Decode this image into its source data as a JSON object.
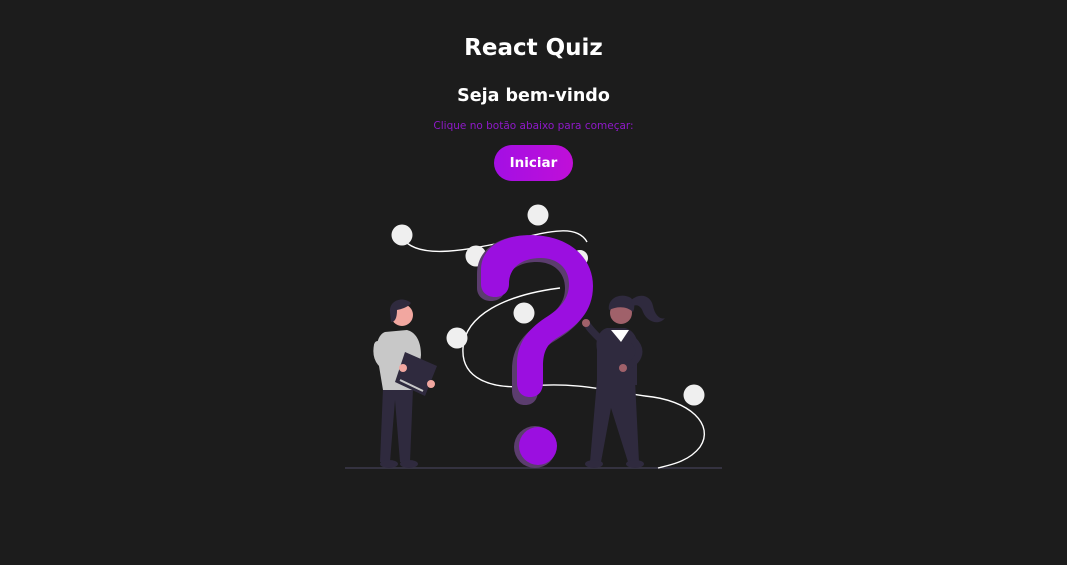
{
  "header": {
    "title": "React Quiz"
  },
  "welcome": {
    "heading": "Seja bem-vindo",
    "instruction": "Clique no botão abaixo para começar:",
    "start_button_label": "Iniciar"
  },
  "colors": {
    "background": "#1c1c1c",
    "accent": "#a30fe4",
    "accent_text": "#8f19c9",
    "question_mark": "#9b0fe0",
    "figure_dark": "#2f2a3e"
  },
  "illustration": {
    "icon": "question-mark-people-illustration"
  }
}
